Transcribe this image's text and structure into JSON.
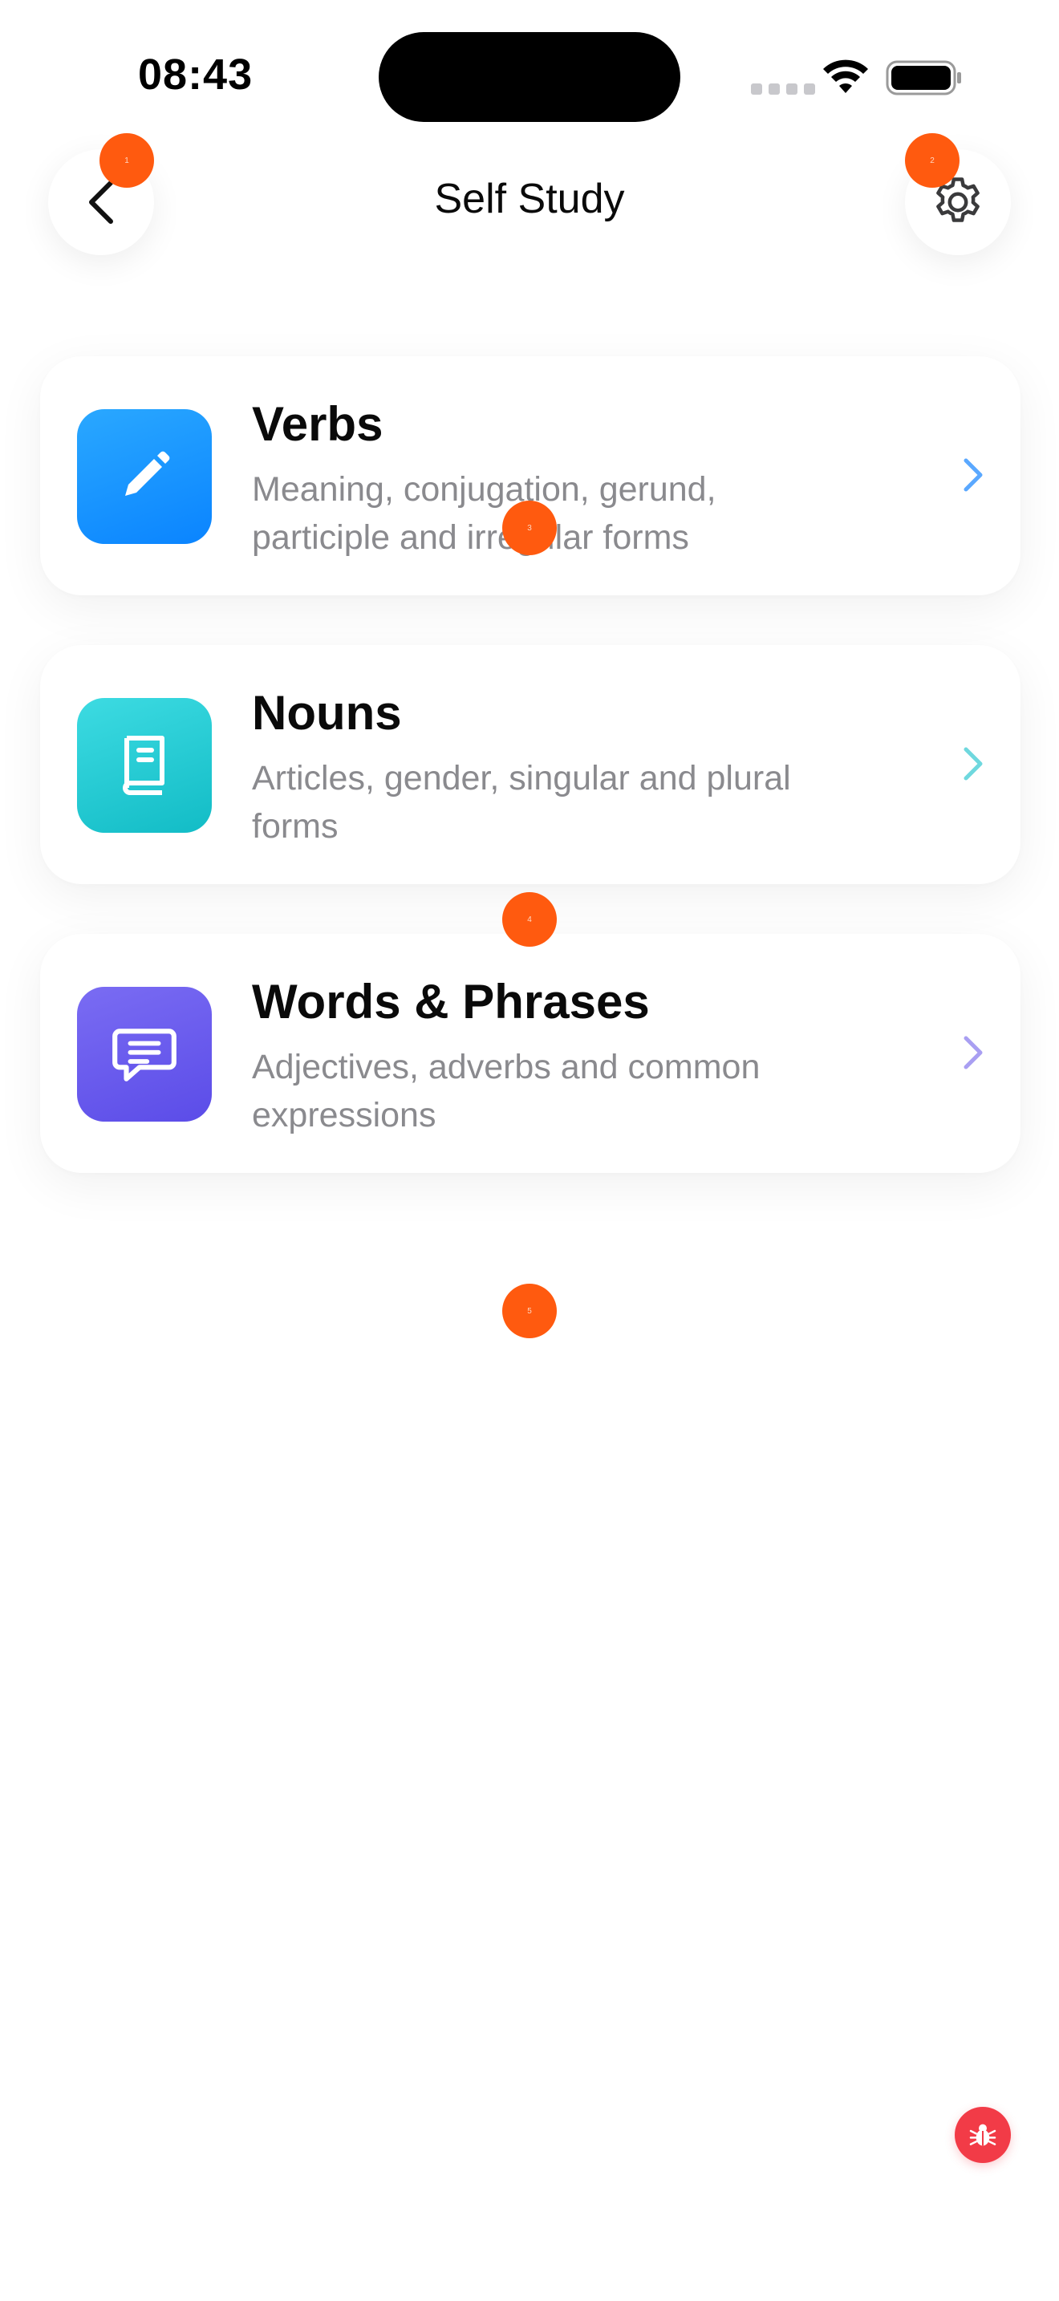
{
  "status_bar": {
    "time": "08:43"
  },
  "header": {
    "title": "Self Study"
  },
  "cards": [
    {
      "title": "Verbs",
      "description": "Meaning, conjugation, gerund, participle and irregular forms",
      "icon": "pencil-icon",
      "color": "#1e90ff",
      "chevron_color": "#5aa8ff"
    },
    {
      "title": "Nouns",
      "description": "Articles, gender, singular and plural forms",
      "icon": "book-icon",
      "color": "#1fc7cf",
      "chevron_color": "#6fd8de"
    },
    {
      "title": "Words & Phrases",
      "description": "Adjectives, adverbs and common expressions",
      "icon": "chat-bubble-icon",
      "color": "#6b5cf0",
      "chevron_color": "#a99ff2"
    }
  ],
  "markers": [
    "1",
    "2",
    "3",
    "4",
    "5"
  ],
  "colors": {
    "marker": "#ff5a0f",
    "debug": "#f23b47"
  }
}
